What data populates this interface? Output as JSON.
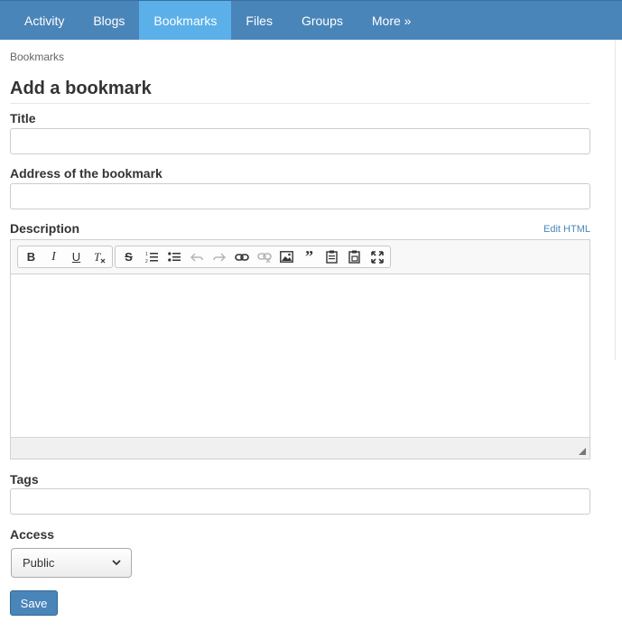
{
  "nav": {
    "tabs": [
      {
        "label": "Activity"
      },
      {
        "label": "Blogs"
      },
      {
        "label": "Bookmarks"
      },
      {
        "label": "Files"
      },
      {
        "label": "Groups"
      },
      {
        "label": "More »"
      }
    ],
    "active_tab": "Bookmarks",
    "accent_color": "#4a85b9",
    "active_color": "#5bb0ea"
  },
  "breadcrumb": "Bookmarks",
  "page_title": "Add a bookmark",
  "form": {
    "title_label": "Title",
    "title_value": "",
    "address_label": "Address of the bookmark",
    "address_value": "",
    "description_label": "Description",
    "edit_html_label": "Edit HTML",
    "editor_toolbar": [
      "bold-icon",
      "italic-icon",
      "underline-icon",
      "remove-format-icon",
      "strikethrough-icon",
      "numbered-list-icon",
      "bulleted-list-icon",
      "undo-icon",
      "redo-icon",
      "link-icon",
      "unlink-icon",
      "image-icon",
      "blockquote-icon",
      "paste-icon",
      "paste-text-icon",
      "maximize-icon"
    ],
    "tags_label": "Tags",
    "tags_value": "",
    "access_label": "Access",
    "access_selected": "Public",
    "save_label": "Save"
  }
}
